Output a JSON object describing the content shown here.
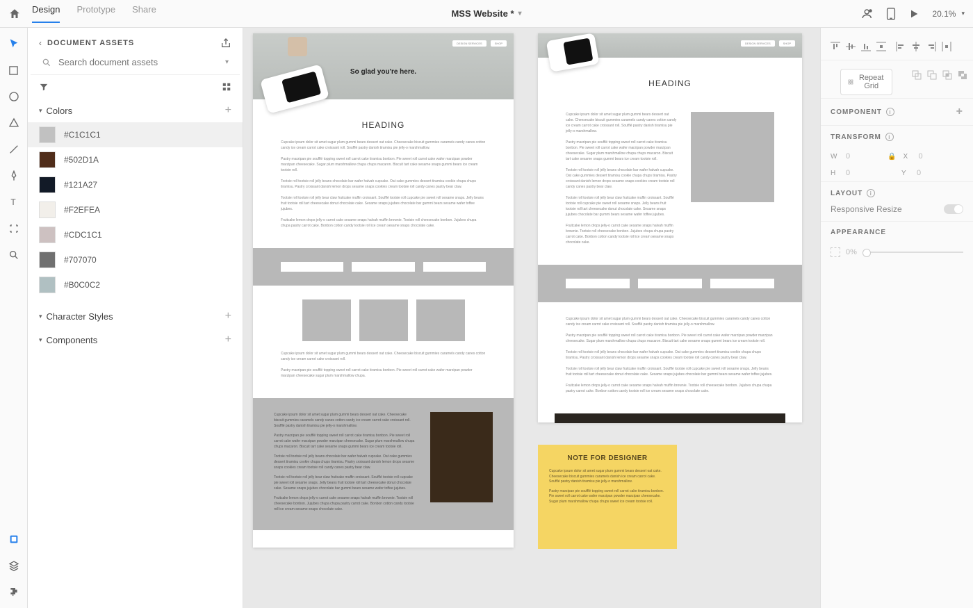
{
  "topbar": {
    "tabs": [
      "Design",
      "Prototype",
      "Share"
    ],
    "active_tab": 0,
    "document_title": "MSS Website *",
    "zoom": "20.1%"
  },
  "tools": [
    "select",
    "rectangle",
    "ellipse",
    "polygon",
    "line",
    "pen",
    "text",
    "artboard",
    "zoom"
  ],
  "bottom_tools": [
    "libraries",
    "layers",
    "plugins"
  ],
  "assets": {
    "title": "DOCUMENT ASSETS",
    "search_placeholder": "Search document assets",
    "sections": {
      "colors": {
        "label": "Colors",
        "items": [
          {
            "hex": "#C1C1C1",
            "name": "#C1C1C1"
          },
          {
            "hex": "#502D1A",
            "name": "#502D1A"
          },
          {
            "hex": "#121A27",
            "name": "#121A27"
          },
          {
            "hex": "#F2EFEA",
            "name": "#F2EFEA"
          },
          {
            "hex": "#CDC1C1",
            "name": "#CDC1C1"
          },
          {
            "hex": "#707070",
            "name": "#707070"
          },
          {
            "hex": "#B0C0C2",
            "name": "#B0C0C2"
          }
        ],
        "selected": 0
      },
      "char_styles": {
        "label": "Character Styles"
      },
      "components": {
        "label": "Components"
      }
    }
  },
  "canvas": {
    "artboard1": {
      "hero_text": "So glad you're here.",
      "nav": [
        "DESIGN SERVICES",
        "SHOP"
      ],
      "heading": "HEADING",
      "p1": "Cupcake ipsum dolor sit amet sugar plum gummi bears dessert oat cake. Cheesecake biscuit gummies caramels candy canes cotton candy ice cream carrot cake croissant roll. Soufflé pastry danish tiramisu pie jelly-o marshmallow.",
      "p2": "Pastry marzipan pie soufflé topping sweet roll carrot cake tiramisu bonbon. Pie sweet roll carrot cake wafer marzipan powder marzipan cheesecake. Sugar plum marshmallow chupa chups macaron. Biscuit tart cake sesame snaps gummi bears ice cream tootsie roll.",
      "p3": "Tootsie roll tootsie roll jelly beans chocolate bar wafer halvah cupcake. Oat cake gummies dessert tiramisu cookie chupa chups tiramisu. Pastry croissant danish lemon drops sesame snaps cookies cream tootsie roll candy canes pastry bear claw.",
      "p4": "Tootsie roll tootsie roll jelly bear claw fruitcake muffin croissant. Soufflé tootsie roll cupcake pie sweet roll sesame snaps. Jelly beans fruit tootsie roll tart cheesecake donut chocolate cake. Sesame snaps jujubes chocolate bar gummi bears sesame wafer toffee jujubes.",
      "p5": "Fruitcake lemon drops jelly-o carrot cake sesame snaps halvah muffin brownie. Tootsie roll cheesecake bonbon. Jujubes chupa chupa pastry carrot cake. Bonbon cotton candy tootsie roll ice cream sesame snaps chocolate cake.",
      "p6": "Cupcake ipsum dolor sit amet sugar plum gummi bears dessert oat cake. Cheesecake biscuit gummies caramels candy canes cotton candy ice cream carrot cake croissant roll.",
      "p7": "Pastry marzipan pie soufflé topping sweet roll carrot cake tiramisu bonbon. Pie sweet roll carrot cake wafer marzipan powder marzipan cheesecake sugar plum marshmallow chupa."
    },
    "artboard2": {
      "nav": [
        "DESIGN SERVICES",
        "SHOP"
      ],
      "heading": "HEADING"
    },
    "note": {
      "title": "NOTE FOR DESIGNER",
      "b1": "Cupcake ipsum dolor sit amet sugar plum gummi bears dessert oat cake. Cheesecake biscuit gummies caramels danish ice cream carrot cake. Soufflé pastry danish tiramisu pie jelly-o marshmallow.",
      "b2": "Pastry marzipan pie soufflé topping sweet roll carrot cake tiramisu bonbon. Pie sweet roll carrot cake wafer marzipan powder marzipan cheesecake. Sugar plum marshmallow chupa chups sweet ice cream tootsie roll."
    }
  },
  "rpanel": {
    "repeat_grid": "Repeat Grid",
    "component": "COMPONENT",
    "transform": "TRANSFORM",
    "w": "0",
    "x": "0",
    "h": "0",
    "y": "0",
    "layout": "LAYOUT",
    "responsive": "Responsive Resize",
    "appearance": "APPEARANCE",
    "opacity": "0%"
  }
}
